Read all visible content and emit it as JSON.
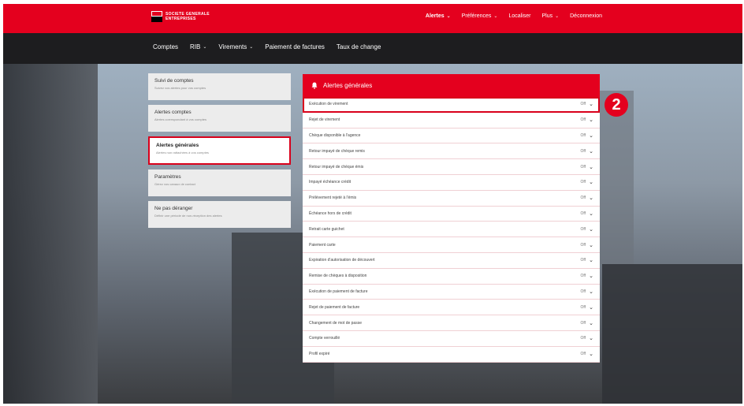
{
  "brand": {
    "line1": "SOCIETE GENERALE",
    "line2": "ENTREPRISES"
  },
  "topnav": [
    {
      "label": "Alertes",
      "chevron": true,
      "bold": true
    },
    {
      "label": "Préférences",
      "chevron": true,
      "bold": false
    },
    {
      "label": "Localiser",
      "chevron": false,
      "bold": false
    },
    {
      "label": "Plus",
      "chevron": true,
      "bold": false
    },
    {
      "label": "Déconnexion",
      "chevron": false,
      "bold": false
    }
  ],
  "subnav": [
    {
      "label": "Comptes",
      "chevron": false
    },
    {
      "label": "RIB",
      "chevron": true
    },
    {
      "label": "Virements",
      "chevron": true
    },
    {
      "label": "Paiement de factures",
      "chevron": false
    },
    {
      "label": "Taux de change",
      "chevron": false
    }
  ],
  "sidebar": [
    {
      "title": "Suivi de comptes",
      "subtitle": "Suivez vos alertes pour vos comptes",
      "active": false
    },
    {
      "title": "Alertes comptes",
      "subtitle": "Alertes correspondant à vos comptes",
      "active": false
    },
    {
      "title": "Alertes générales",
      "subtitle": "Alertes non rattachées à vos comptes",
      "active": true
    },
    {
      "title": "Paramètres",
      "subtitle": "Gérez vos canaux de contact",
      "active": false
    },
    {
      "title": "Ne pas déranger",
      "subtitle": "Définir une période de non-réception des alertes",
      "active": false
    }
  ],
  "panel": {
    "title": "Alertes générales",
    "icon": "bell-icon",
    "rows": [
      {
        "label": "Exécution de virement",
        "value": "Off",
        "selected": true
      },
      {
        "label": "Rejet de virement",
        "value": "Off",
        "selected": false
      },
      {
        "label": "Chèque disponible à l'agence",
        "value": "Off",
        "selected": false
      },
      {
        "label": "Retour impayé de chèque remis",
        "value": "Off",
        "selected": false
      },
      {
        "label": "Retour impayé de chèque émis",
        "value": "Off",
        "selected": false
      },
      {
        "label": "Impayé échéance crédit",
        "value": "Off",
        "selected": false
      },
      {
        "label": "Prélèvement rejeté à l'émis",
        "value": "Off",
        "selected": false
      },
      {
        "label": "Échéance hors de crédit",
        "value": "Off",
        "selected": false
      },
      {
        "label": "Retrait carte guichet",
        "value": "Off",
        "selected": false
      },
      {
        "label": "Paiement carte",
        "value": "Off",
        "selected": false
      },
      {
        "label": "Expiration d'autorisation de découvert",
        "value": "Off",
        "selected": false
      },
      {
        "label": "Remise de chèques à disposition",
        "value": "Off",
        "selected": false
      },
      {
        "label": "Exécution de paiement de facture",
        "value": "Off",
        "selected": false
      },
      {
        "label": "Rejet de paiement de facture",
        "value": "Off",
        "selected": false
      },
      {
        "label": "Changement de mot de passe",
        "value": "Off",
        "selected": false
      },
      {
        "label": "Compte verrouillé",
        "value": "Off",
        "selected": false
      },
      {
        "label": "Profil expiré",
        "value": "Off",
        "selected": false
      }
    ]
  },
  "badge": "2",
  "colors": {
    "brand_red": "#e4001e",
    "nav_dark": "#1d1d1f"
  }
}
